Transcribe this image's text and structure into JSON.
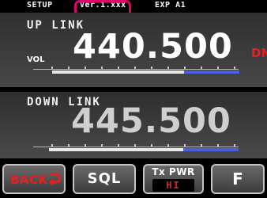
{
  "status_bar": {
    "mode": "SETUP",
    "version": "Ver.1.xxx",
    "exp": "EXP A1"
  },
  "up_link": {
    "title": "UP LINK",
    "frequency": "440.500",
    "indicator": "DN",
    "vol_label": "VOL"
  },
  "down_link": {
    "title": "DOWN LINK",
    "frequency": "445.500"
  },
  "buttons": {
    "back_label": "BACK",
    "sql_label": "SQL",
    "txpwr_label": "Tx PWR",
    "txpwr_value": "HI",
    "f_label": "F"
  },
  "colors": {
    "highlight": "#e0006e",
    "warning_red": "#e62020",
    "meter_blue": "#4a5ee0"
  },
  "icons": {
    "back": "return-arrow-icon"
  }
}
